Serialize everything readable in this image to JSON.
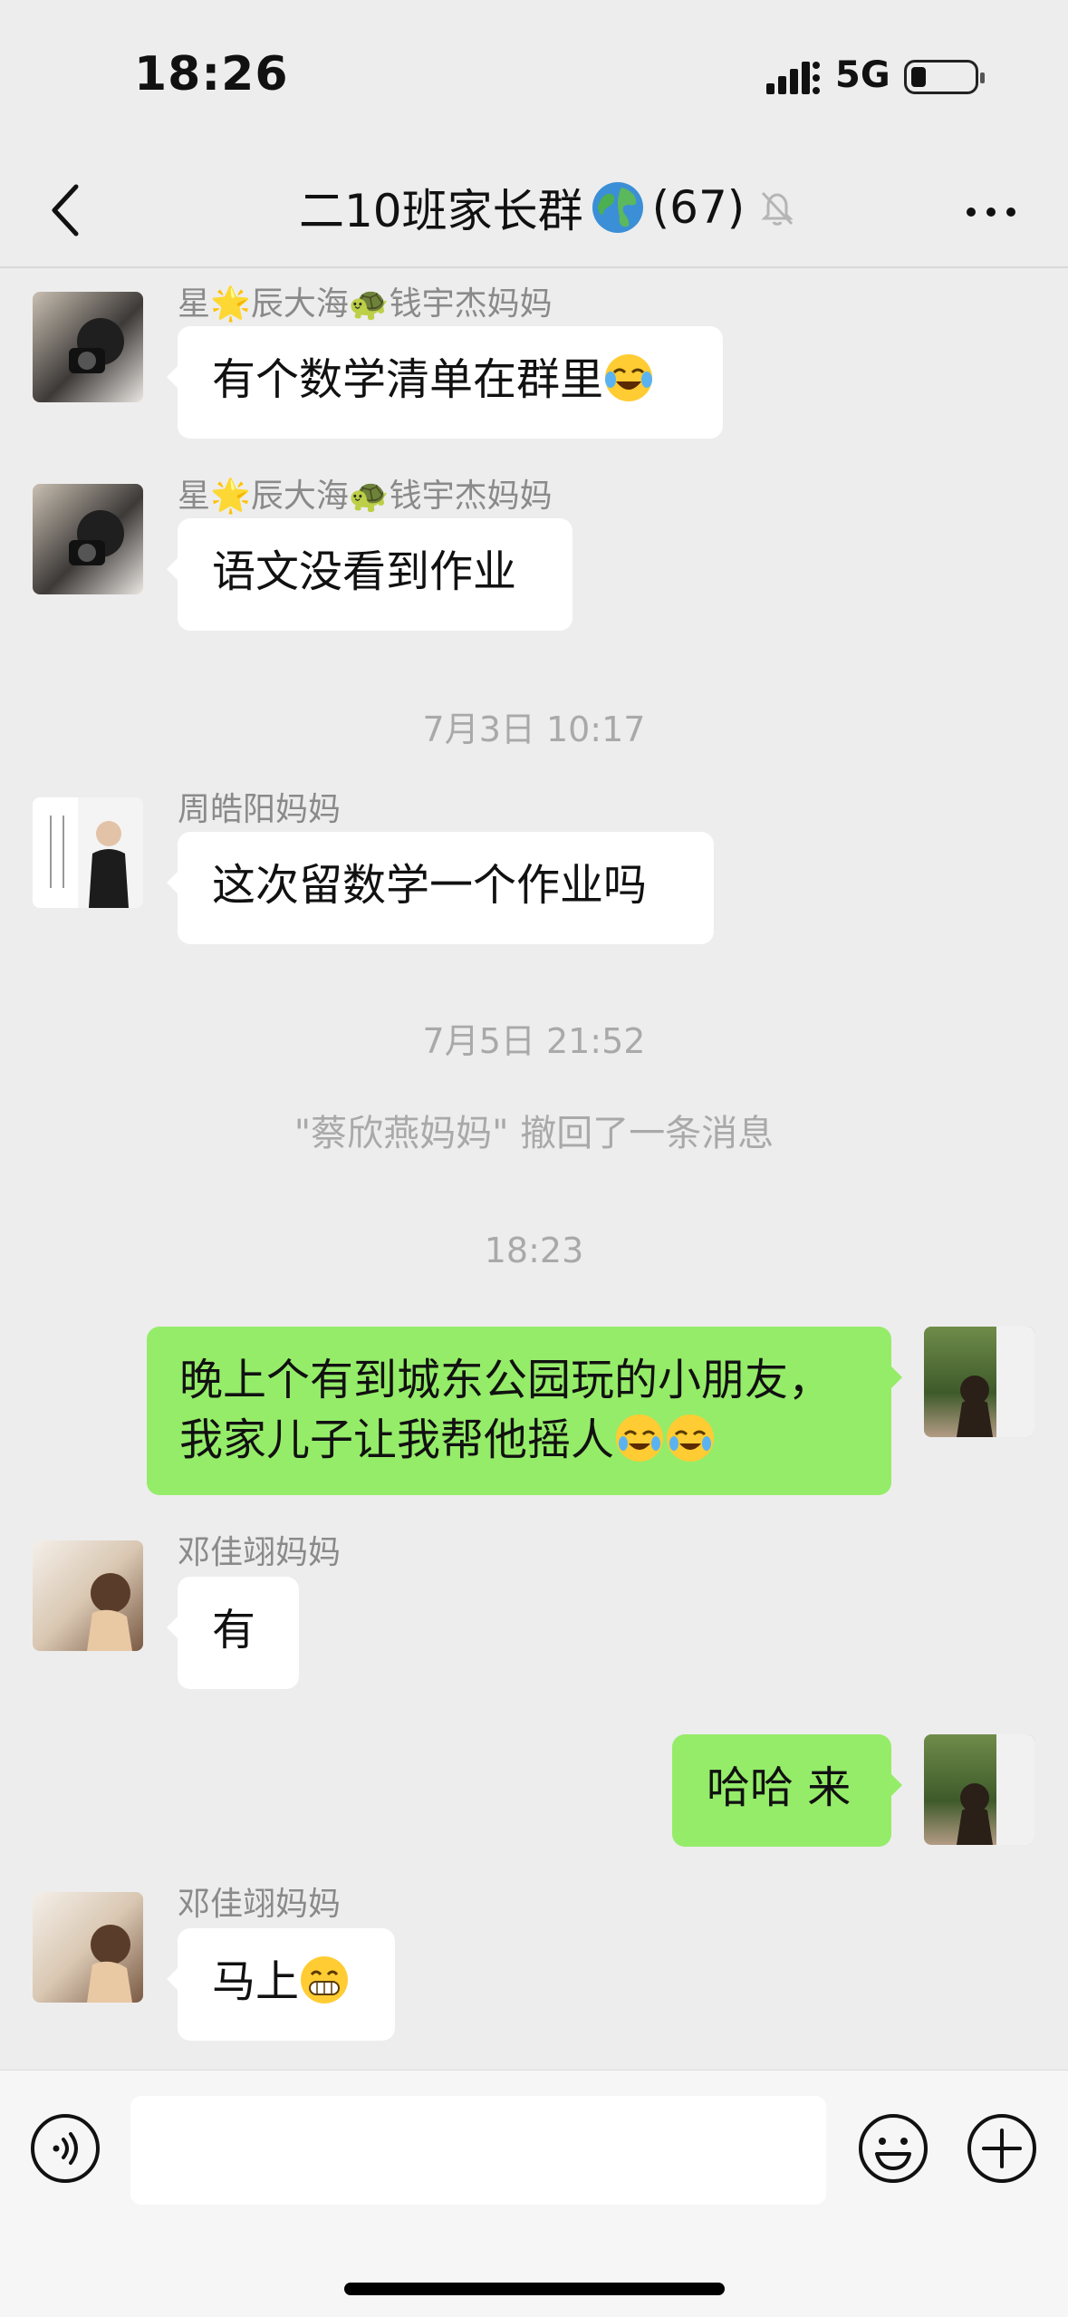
{
  "status_bar": {
    "time": "18:26",
    "network": "5G"
  },
  "header": {
    "title": "二10班家长群",
    "member_count": "(67)"
  },
  "messages": [
    {
      "sender": "星🌟辰大海🐢钱宇杰妈妈",
      "text": "有个数学清单在群里"
    },
    {
      "sender": "星🌟辰大海🐢钱宇杰妈妈",
      "text": "语文没看到作业"
    },
    {
      "timestamp": "7月3日 10:17"
    },
    {
      "sender": "周皓阳妈妈",
      "text": "这次留数学一个作业吗"
    },
    {
      "timestamp": "7月5日 21:52"
    },
    {
      "system": "\"蔡欣燕妈妈\" 撤回了一条消息"
    },
    {
      "timestamp": "18:23"
    },
    {
      "sender": "me",
      "text": "晚上个有到城东公园玩的小朋友，我家儿子让我帮他摇人"
    },
    {
      "sender": "邓佳翊妈妈",
      "text": "有"
    },
    {
      "sender": "me",
      "text": "哈哈 来"
    },
    {
      "sender": "邓佳翊妈妈",
      "text": "马上"
    }
  ],
  "colors": {
    "background": "#ededed",
    "outgoing_bubble": "#95ec69",
    "incoming_bubble": "#ffffff",
    "meta_text": "#a9a9a9"
  },
  "icons": [
    "chevron-left-icon",
    "globe-icon",
    "mute-bell-icon",
    "more-dots-icon",
    "voice-icon",
    "emoji-icon",
    "plus-icon"
  ]
}
